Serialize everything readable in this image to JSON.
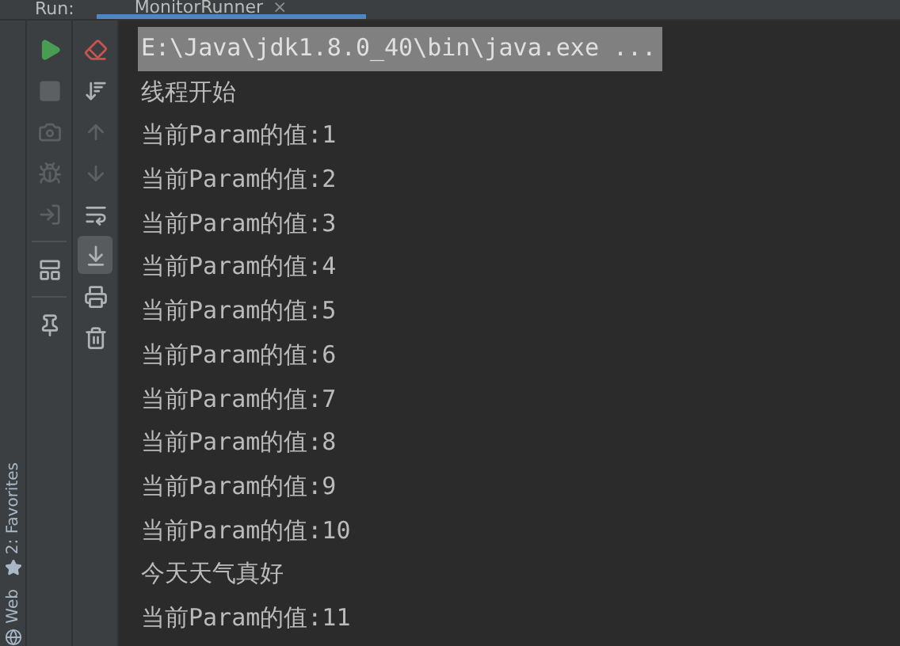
{
  "run_bar": {
    "label": "Run:",
    "tab": {
      "title": "MonitorRunner",
      "close": "×"
    }
  },
  "side_tabs": [
    {
      "label": "2: Favorites",
      "kind": "star"
    },
    {
      "label": "Web",
      "kind": "globe"
    }
  ],
  "toolbar_left": [
    {
      "kind": "play",
      "disabled": false
    },
    {
      "kind": "stop",
      "disabled": true
    },
    {
      "kind": "camera",
      "disabled": true
    },
    {
      "kind": "bug",
      "disabled": true
    },
    {
      "kind": "exit",
      "disabled": true
    },
    {
      "kind": "layout",
      "disabled": false
    },
    {
      "kind": "pin",
      "disabled": false
    }
  ],
  "toolbar_right": [
    {
      "kind": "eraser",
      "disabled": false,
      "selected": false
    },
    {
      "kind": "sort",
      "disabled": false,
      "selected": false
    },
    {
      "kind": "up",
      "disabled": true,
      "selected": false
    },
    {
      "kind": "down",
      "disabled": true,
      "selected": false
    },
    {
      "kind": "wrap",
      "disabled": false,
      "selected": false
    },
    {
      "kind": "scroll",
      "disabled": false,
      "selected": true
    },
    {
      "kind": "print",
      "disabled": false,
      "selected": false
    },
    {
      "kind": "trash",
      "disabled": false,
      "selected": false
    }
  ],
  "console_lines": [
    {
      "text": "E:\\Java\\jdk1.8.0_40\\bin\\java.exe ...",
      "kind": "command"
    },
    {
      "text": "线程开始",
      "kind": "output"
    },
    {
      "text": "当前Param的值:1",
      "kind": "output"
    },
    {
      "text": "当前Param的值:2",
      "kind": "output"
    },
    {
      "text": "当前Param的值:3",
      "kind": "output"
    },
    {
      "text": "当前Param的值:4",
      "kind": "output"
    },
    {
      "text": "当前Param的值:5",
      "kind": "output"
    },
    {
      "text": "当前Param的值:6",
      "kind": "output"
    },
    {
      "text": "当前Param的值:7",
      "kind": "output"
    },
    {
      "text": "当前Param的值:8",
      "kind": "output"
    },
    {
      "text": "当前Param的值:9",
      "kind": "output"
    },
    {
      "text": "当前Param的值:10",
      "kind": "output"
    },
    {
      "text": "今天天气真好",
      "kind": "output"
    },
    {
      "text": "当前Param的值:11",
      "kind": "output"
    }
  ]
}
